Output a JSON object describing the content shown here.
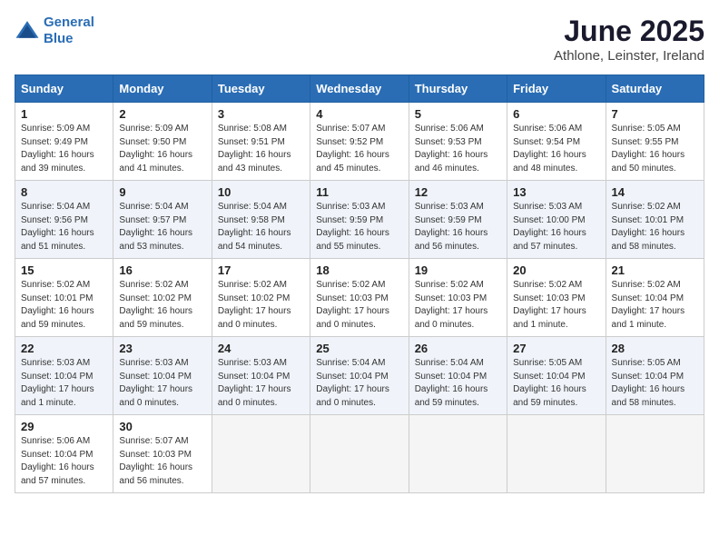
{
  "logo": {
    "line1": "General",
    "line2": "Blue"
  },
  "title": "June 2025",
  "subtitle": "Athlone, Leinster, Ireland",
  "days_of_week": [
    "Sunday",
    "Monday",
    "Tuesday",
    "Wednesday",
    "Thursday",
    "Friday",
    "Saturday"
  ],
  "weeks": [
    [
      {
        "day": "1",
        "sunrise": "5:09 AM",
        "sunset": "9:49 PM",
        "daylight": "16 hours and 39 minutes."
      },
      {
        "day": "2",
        "sunrise": "5:09 AM",
        "sunset": "9:50 PM",
        "daylight": "16 hours and 41 minutes."
      },
      {
        "day": "3",
        "sunrise": "5:08 AM",
        "sunset": "9:51 PM",
        "daylight": "16 hours and 43 minutes."
      },
      {
        "day": "4",
        "sunrise": "5:07 AM",
        "sunset": "9:52 PM",
        "daylight": "16 hours and 45 minutes."
      },
      {
        "day": "5",
        "sunrise": "5:06 AM",
        "sunset": "9:53 PM",
        "daylight": "16 hours and 46 minutes."
      },
      {
        "day": "6",
        "sunrise": "5:06 AM",
        "sunset": "9:54 PM",
        "daylight": "16 hours and 48 minutes."
      },
      {
        "day": "7",
        "sunrise": "5:05 AM",
        "sunset": "9:55 PM",
        "daylight": "16 hours and 50 minutes."
      }
    ],
    [
      {
        "day": "8",
        "sunrise": "5:04 AM",
        "sunset": "9:56 PM",
        "daylight": "16 hours and 51 minutes."
      },
      {
        "day": "9",
        "sunrise": "5:04 AM",
        "sunset": "9:57 PM",
        "daylight": "16 hours and 53 minutes."
      },
      {
        "day": "10",
        "sunrise": "5:04 AM",
        "sunset": "9:58 PM",
        "daylight": "16 hours and 54 minutes."
      },
      {
        "day": "11",
        "sunrise": "5:03 AM",
        "sunset": "9:59 PM",
        "daylight": "16 hours and 55 minutes."
      },
      {
        "day": "12",
        "sunrise": "5:03 AM",
        "sunset": "9:59 PM",
        "daylight": "16 hours and 56 minutes."
      },
      {
        "day": "13",
        "sunrise": "5:03 AM",
        "sunset": "10:00 PM",
        "daylight": "16 hours and 57 minutes."
      },
      {
        "day": "14",
        "sunrise": "5:02 AM",
        "sunset": "10:01 PM",
        "daylight": "16 hours and 58 minutes."
      }
    ],
    [
      {
        "day": "15",
        "sunrise": "5:02 AM",
        "sunset": "10:01 PM",
        "daylight": "16 hours and 59 minutes."
      },
      {
        "day": "16",
        "sunrise": "5:02 AM",
        "sunset": "10:02 PM",
        "daylight": "16 hours and 59 minutes."
      },
      {
        "day": "17",
        "sunrise": "5:02 AM",
        "sunset": "10:02 PM",
        "daylight": "17 hours and 0 minutes."
      },
      {
        "day": "18",
        "sunrise": "5:02 AM",
        "sunset": "10:03 PM",
        "daylight": "17 hours and 0 minutes."
      },
      {
        "day": "19",
        "sunrise": "5:02 AM",
        "sunset": "10:03 PM",
        "daylight": "17 hours and 0 minutes."
      },
      {
        "day": "20",
        "sunrise": "5:02 AM",
        "sunset": "10:03 PM",
        "daylight": "17 hours and 1 minute."
      },
      {
        "day": "21",
        "sunrise": "5:02 AM",
        "sunset": "10:04 PM",
        "daylight": "17 hours and 1 minute."
      }
    ],
    [
      {
        "day": "22",
        "sunrise": "5:03 AM",
        "sunset": "10:04 PM",
        "daylight": "17 hours and 1 minute."
      },
      {
        "day": "23",
        "sunrise": "5:03 AM",
        "sunset": "10:04 PM",
        "daylight": "17 hours and 0 minutes."
      },
      {
        "day": "24",
        "sunrise": "5:03 AM",
        "sunset": "10:04 PM",
        "daylight": "17 hours and 0 minutes."
      },
      {
        "day": "25",
        "sunrise": "5:04 AM",
        "sunset": "10:04 PM",
        "daylight": "17 hours and 0 minutes."
      },
      {
        "day": "26",
        "sunrise": "5:04 AM",
        "sunset": "10:04 PM",
        "daylight": "16 hours and 59 minutes."
      },
      {
        "day": "27",
        "sunrise": "5:05 AM",
        "sunset": "10:04 PM",
        "daylight": "16 hours and 59 minutes."
      },
      {
        "day": "28",
        "sunrise": "5:05 AM",
        "sunset": "10:04 PM",
        "daylight": "16 hours and 58 minutes."
      }
    ],
    [
      {
        "day": "29",
        "sunrise": "5:06 AM",
        "sunset": "10:04 PM",
        "daylight": "16 hours and 57 minutes."
      },
      {
        "day": "30",
        "sunrise": "5:07 AM",
        "sunset": "10:03 PM",
        "daylight": "16 hours and 56 minutes."
      },
      null,
      null,
      null,
      null,
      null
    ]
  ]
}
